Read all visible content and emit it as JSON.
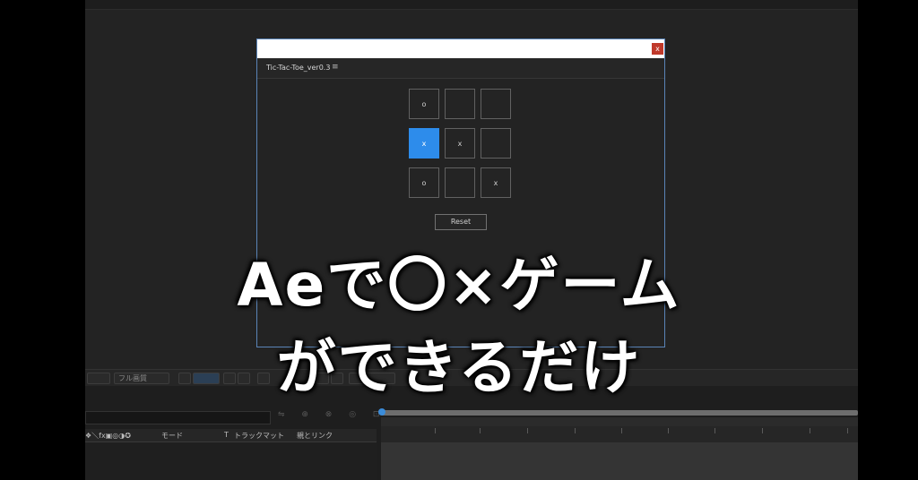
{
  "dialog": {
    "close_label": "x",
    "panel_title": "Tic-Tac-Toe_ver0.3",
    "menu_icon": "≡",
    "reset_label": "Reset"
  },
  "board": {
    "cells": [
      "o",
      "",
      "",
      "x",
      "x",
      "",
      "o",
      "",
      "x"
    ],
    "highlighted_cell": 3,
    "highlight_color": "#2d8ceb"
  },
  "timeline": {
    "col_mode": "モード",
    "col_t": "T",
    "col_track_matte": "トラックマット",
    "col_parent_link": "親とリンク",
    "switch_icons": "❖＼fx▣◎◑✪",
    "toolbar_zoom": "フル画質"
  },
  "caption": {
    "line1": "Aeで〇×ゲーム",
    "line2": "ができるだけ"
  }
}
